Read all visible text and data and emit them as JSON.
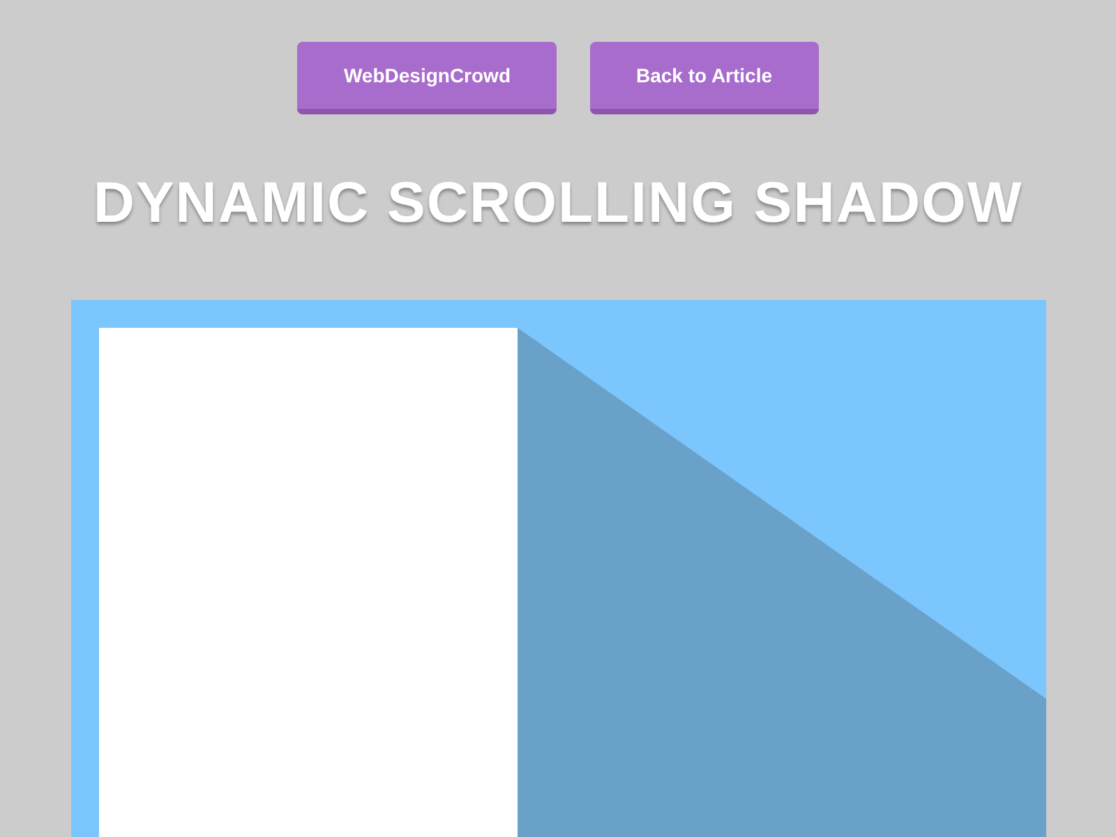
{
  "nav_buttons": [
    {
      "label": "WebDesignCrowd"
    },
    {
      "label": "Back to Article"
    }
  ],
  "title": "DYNAMIC SCROLLING SHADOW"
}
